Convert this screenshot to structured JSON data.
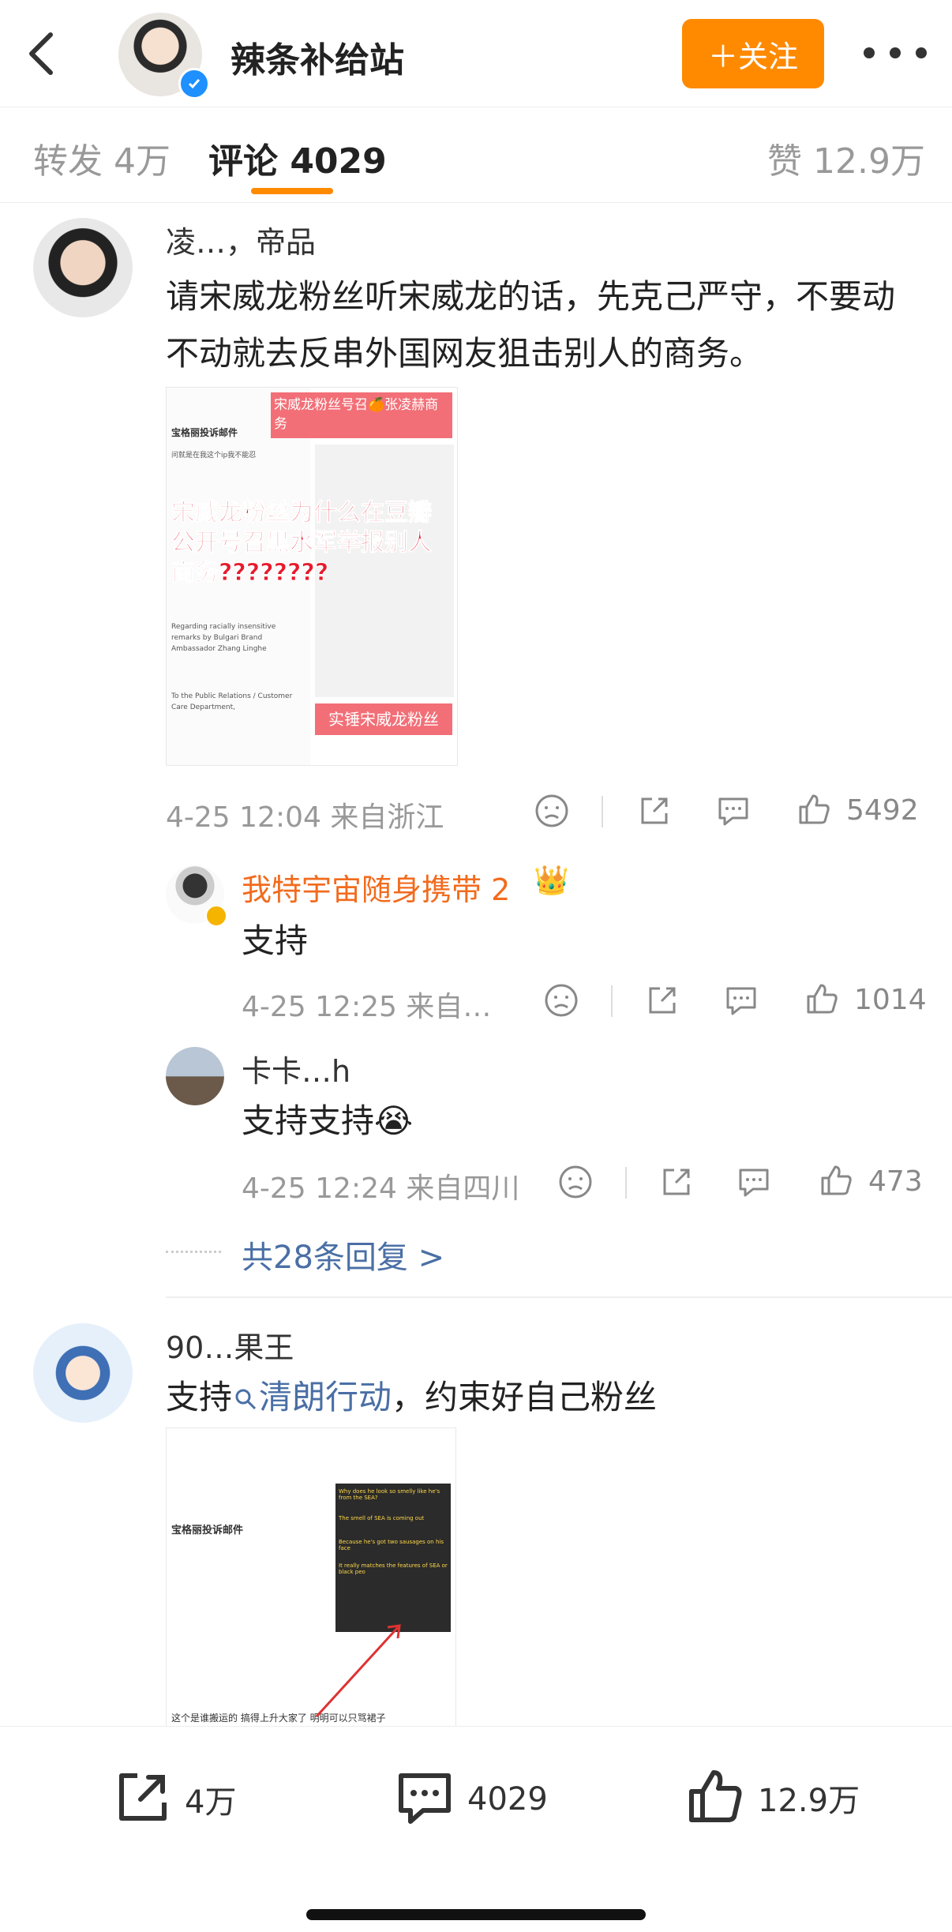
{
  "header": {
    "title": "辣条补给站",
    "follow_label": "＋关注"
  },
  "tabs": {
    "repost": "转发 4万",
    "comments": "评论 4029",
    "likes": "赞 12.9万"
  },
  "comments": [
    {
      "username": "凌…，帝品",
      "text": "请宋威龙粉丝听宋威龙的话，先克己严守，不要动不动就去反串外国网友狙击别人的商务。",
      "image": {
        "left_title": "宝格丽投诉邮件",
        "red_title_1": "宋威龙粉丝号召🍊张凌赫商务",
        "overlay_text": "宋威龙粉丝为什么在豆瓣公开号召黑水军举报别人商务????????",
        "bottom_label": "实锤宋威龙粉丝",
        "email_line_1": "问就是在我这个ip我不能忍",
        "email_subject": "Regarding racially insensitive remarks by Bulgari Brand Ambassador Zhang Linghe",
        "email_to": "To the Public Relations / Customer Care Department,"
      },
      "time_location": "4-25 12:04 来自浙江",
      "likes": "5492",
      "replies": [
        {
          "username": "我特宇宙随身携带 2",
          "text": "支持",
          "time_location": "4-25 12:25 来自…",
          "likes": "1014"
        },
        {
          "username": "卡卡…h",
          "text": "支持支持😭",
          "time_location": "4-25 12:24 来自四川",
          "likes": "473"
        }
      ],
      "more_replies": "共28条回复 >"
    },
    {
      "username": "90…果王",
      "text_prefix": "支持",
      "topic": "清朗行动",
      "text_suffix": "，约束好自己粉丝",
      "image": {
        "left_title": "宝格丽投诉邮件",
        "caption_1": "这个是谁搬运的 搞得上升大家了 明明可以只骂裙子",
        "dark_text_1": "Why does he look so smelly like he's from the SEA?",
        "dark_text_2": "The smell of SEA is coming out",
        "dark_text_3": "Because he's got two sausages on his face",
        "dark_text_4": "It really matches the features of SEA or black peo"
      }
    }
  ],
  "bottom": {
    "reposts": "4万",
    "comments": "4029",
    "likes": "12.9万"
  }
}
